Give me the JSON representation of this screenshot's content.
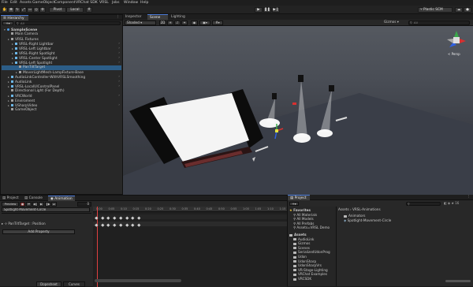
{
  "menu": [
    "File",
    "Edit",
    "Assets",
    "GameObject",
    "Component",
    "VRChat SDK",
    "VRSL",
    "Jobs",
    "Window",
    "Help"
  ],
  "toolbar": {
    "pivot_label": "Pivot",
    "local_label": "Local",
    "account_label": "Plastic SCM"
  },
  "hierarchy": {
    "tab": "Hierarchy",
    "search_placeholder": "All",
    "rows": [
      {
        "label": "SampleScene",
        "indent": 0,
        "bold": true,
        "icon": "scene"
      },
      {
        "label": "Main Camera",
        "indent": 1,
        "icon": "obj"
      },
      {
        "label": "VRSL Fixtures",
        "indent": 1,
        "icon": "obj",
        "arrow": true
      },
      {
        "label": "VRSL-Right Lightbar",
        "indent": 2,
        "icon": "prefab",
        "arrow": true
      },
      {
        "label": "VRSL-Left Lightbar",
        "indent": 2,
        "icon": "prefab",
        "arrow": true
      },
      {
        "label": "VRSL-Right Spotlight",
        "indent": 2,
        "icon": "prefab",
        "arrow": true
      },
      {
        "label": "VRSL-Center Spotlight",
        "indent": 2,
        "icon": "prefab",
        "arrow": true
      },
      {
        "label": "VRSL-Left Spotlight",
        "indent": 2,
        "icon": "prefab",
        "arrow": true
      },
      {
        "label": "PanTiltTarget",
        "indent": 3,
        "icon": "obj",
        "selected": true
      },
      {
        "label": "MoverLightMesh-LampFixture-Base",
        "indent": 3,
        "icon": "obj",
        "arrow": true
      },
      {
        "label": "AudioLinkController-WithVRSLSmoothing",
        "indent": 1,
        "icon": "prefab",
        "arrow": true
      },
      {
        "label": "AudioLink",
        "indent": 1,
        "icon": "prefab",
        "arrow": true
      },
      {
        "label": "VRSL-LocalUIControlPanel",
        "indent": 1,
        "icon": "prefab",
        "arrow": true
      },
      {
        "label": "Directional Light (For Depth)",
        "indent": 1,
        "icon": "obj"
      },
      {
        "label": "VRCWorld",
        "indent": 1,
        "icon": "prefab",
        "arrow": true
      },
      {
        "label": "Enviroment",
        "indent": 1,
        "icon": "obj",
        "arrow": true
      },
      {
        "label": "USharpVideo",
        "indent": 1,
        "icon": "prefab",
        "arrow": true
      },
      {
        "label": "GameObject",
        "indent": 1,
        "icon": "obj"
      }
    ]
  },
  "scene": {
    "tabs": [
      "Inspector",
      "Scene",
      "Lighting"
    ],
    "shading": "Shaded",
    "mode_2d": "2D",
    "gizmos": "Gizmos",
    "search_placeholder": "All",
    "view_label": "< Persp"
  },
  "bottom": {
    "tabs": [
      "Project",
      "Console",
      "Animation"
    ],
    "preview_label": "Preview",
    "clip_name": "Spotlight-Movement-Circle",
    "property": "PanTiltTarget : Position",
    "add_property": "Add Property",
    "frame_value": "0",
    "ruler": [
      "0:00",
      "0:05",
      "0:10",
      "0:15",
      "0:20",
      "0:25",
      "0:30",
      "0:35",
      "0:40",
      "0:45",
      "0:50",
      "0:55",
      "1:00",
      "1:05",
      "1:10",
      "1:15"
    ],
    "footer_tabs": [
      "Dopesheet",
      "Curves"
    ]
  },
  "project": {
    "tab": "Project",
    "favorites_label": "Favorites",
    "favorites": [
      "All Materials",
      "All Models",
      "All Prefabs",
      "Assets=VRSL Demo"
    ],
    "assets_label": "Assets",
    "folders": [
      "AudioLink",
      "Gizmos",
      "Scenes",
      "SerializedUdonProg",
      "Udon",
      "UdonSharp",
      "UdonSharpVrs",
      "VR-Stage-Lighting",
      "VRChat Examples",
      "VRCSDK"
    ],
    "breadcrumb": [
      "Assets",
      "VRSL-Animations"
    ],
    "files": [
      "Animators",
      "Spotlight-Movement-Circle"
    ],
    "count_label": "16"
  }
}
